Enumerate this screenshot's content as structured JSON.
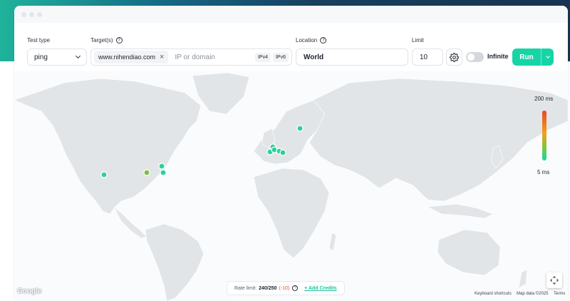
{
  "form": {
    "test_type_label": "Test type",
    "test_type_value": "ping",
    "targets_label": "Target(s)",
    "target_chip": "www.nihendiao.com",
    "target_placeholder": "IP or domain",
    "ipv4": "IPv4",
    "ipv6": "IPv6",
    "location_label": "Location",
    "location_value": "World",
    "limit_label": "Limit",
    "limit_value": "10",
    "infinite_label": "Infinite",
    "infinite_on": false,
    "run_label": "Run"
  },
  "map": {
    "scale_max": "200 ms",
    "scale_min": "5 ms",
    "scale_colors": [
      "#e6462a",
      "#f2a01c",
      "#7ac943",
      "#17d4a7"
    ],
    "probe_colors": {
      "fast": "#2fcf9a",
      "medium": "#7cbf4a"
    },
    "probes": [
      {
        "region": "us-west",
        "speed": "fast"
      },
      {
        "region": "us-central",
        "speed": "medium"
      },
      {
        "region": "us-east-north",
        "speed": "fast"
      },
      {
        "region": "us-east",
        "speed": "fast"
      },
      {
        "region": "uk",
        "speed": "fast"
      },
      {
        "region": "europe-west-1",
        "speed": "fast"
      },
      {
        "region": "europe-west-2",
        "speed": "fast"
      },
      {
        "region": "europe-central-1",
        "speed": "fast"
      },
      {
        "region": "europe-central-2",
        "speed": "fast"
      },
      {
        "region": "nordics",
        "speed": "fast"
      }
    ]
  },
  "rate": {
    "prefix": "Rate limit:",
    "value": "240/250",
    "delta": "(-10)",
    "credits": "+ Add Credits"
  },
  "footer": {
    "google": "Google",
    "shortcuts": "Keyboard shortcuts",
    "map_data": "Map data ©2025",
    "terms": "Terms"
  }
}
